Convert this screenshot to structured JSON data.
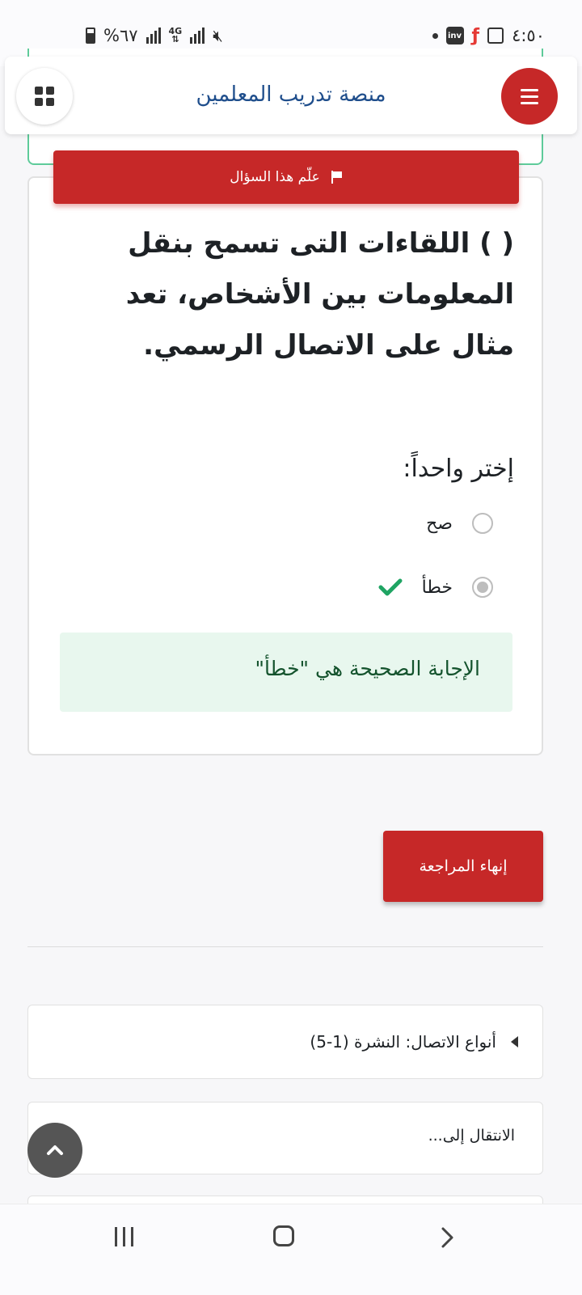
{
  "status_bar": {
    "battery": "%٦٧",
    "network": "4G",
    "time": "٤:٥٠",
    "app_badge": "inv"
  },
  "header": {
    "site_title": "منصة تدريب المعلمين"
  },
  "question": {
    "flag_label": "علّم هذا السؤال",
    "text": "(       ) اللقاءات التى تسمح بنقل المعلومات بين الأشخاص، تعد مثال على الاتصال الرسمي.",
    "prompt": "إختر واحداً:",
    "options": [
      {
        "label": "صح",
        "selected": false
      },
      {
        "label": "خطأ",
        "selected": true,
        "correct": true
      }
    ],
    "feedback": "الإجابة الصحيحة هي \"خطأ\""
  },
  "actions": {
    "finish_review": "إنهاء المراجعة"
  },
  "navigation": {
    "previous_activity": "أنواع الاتصال: النشرة (1-5)",
    "jump_to": "الانتقال إلى..."
  },
  "colors": {
    "primary": "#c62828",
    "title": "#1f4e8c",
    "correct": "#1fa463",
    "feedback_bg": "#e8f7ee"
  }
}
